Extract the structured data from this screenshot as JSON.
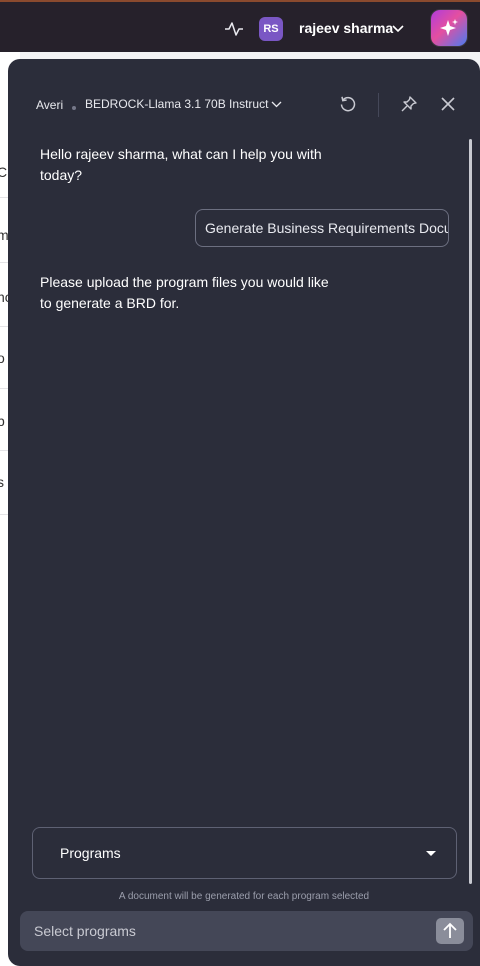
{
  "topbar": {
    "user_initials": "RS",
    "user_name": "rajeev sharma"
  },
  "background_fragments": [
    "C",
    "m",
    "no",
    "o",
    "b",
    "s"
  ],
  "panel": {
    "assistant_name": "Averi",
    "model": "BEDROCK-Llama 3.1 70B Instruct",
    "messages": {
      "greeting": "Hello rajeev sharma, what can I help you with today?",
      "suggestion": "Generate Business Requirements Document",
      "upload_prompt": "Please upload the program files you would like to generate a BRD for."
    },
    "programs_select": {
      "label": "Programs"
    },
    "hint": "A document will be generated for each program selected",
    "input": {
      "placeholder": "Select programs"
    }
  },
  "colors": {
    "panel_bg": "#2b2d3a",
    "topbar_bg": "#26212b",
    "avatar": "#7a57c4",
    "input_bg": "#444757"
  },
  "icons": {
    "activity": "activity-icon",
    "chevron": "chevron-down-icon",
    "ai": "sparkle-icon",
    "reset": "refresh-icon",
    "pin": "pin-icon",
    "close": "close-icon",
    "send": "arrow-up-icon"
  }
}
